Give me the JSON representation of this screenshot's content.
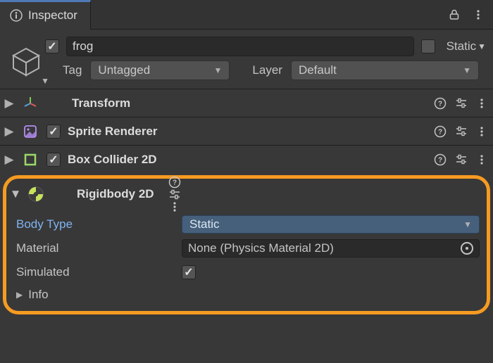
{
  "tab": {
    "title": "Inspector"
  },
  "header": {
    "enabled_checked": true,
    "name": "frog",
    "static_label": "Static"
  },
  "tagrow": {
    "tag_label": "Tag",
    "tag_value": "Untagged",
    "layer_label": "Layer",
    "layer_value": "Default"
  },
  "components": {
    "transform": {
      "name": "Transform"
    },
    "sprite": {
      "name": "Sprite Renderer"
    },
    "box": {
      "name": "Box Collider 2D"
    },
    "rigid": {
      "name": "Rigidbody 2D"
    }
  },
  "rigid_props": {
    "body_type_label": "Body Type",
    "body_type_value": "Static",
    "material_label": "Material",
    "material_value": "None (Physics Material 2D)",
    "simulated_label": "Simulated",
    "simulated_checked": true,
    "info_label": "Info"
  }
}
